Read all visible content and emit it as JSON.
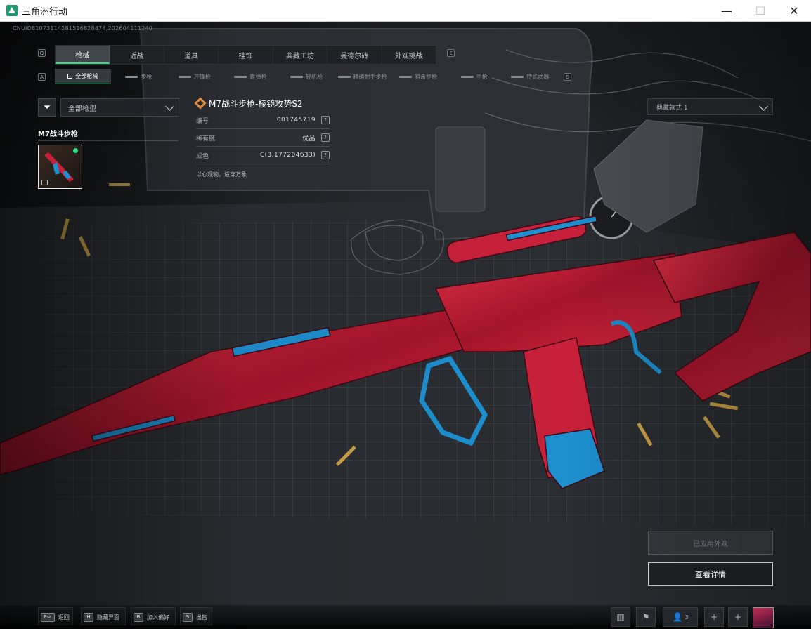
{
  "window": {
    "title": "三角洲行动",
    "controls": {
      "minimize": "—",
      "maximize": "☐",
      "close": "✕"
    }
  },
  "uid": "CNUID8107311428151682887​4,202604111240",
  "tabs": {
    "left_key": "Q",
    "right_key": "E",
    "items": [
      {
        "label": "枪械",
        "active": true
      },
      {
        "label": "近战",
        "active": false
      },
      {
        "label": "道具",
        "active": false
      },
      {
        "label": "挂饰",
        "active": false
      },
      {
        "label": "典藏工坊",
        "active": false
      },
      {
        "label": "曼德尔砖",
        "active": false
      },
      {
        "label": "外观挑战",
        "active": false
      }
    ]
  },
  "subtabs": {
    "left_key": "A",
    "right_key": "D",
    "items": [
      {
        "label": "全部枪械",
        "active": true
      },
      {
        "label": "步枪",
        "active": false
      },
      {
        "label": "冲锋枪",
        "active": false
      },
      {
        "label": "霰弹枪",
        "active": false
      },
      {
        "label": "轻机枪",
        "active": false
      },
      {
        "label": "精确射手步枪",
        "active": false
      },
      {
        "label": "狙击步枪",
        "active": false
      },
      {
        "label": "手枪",
        "active": false
      },
      {
        "label": "特殊武器",
        "active": false
      }
    ]
  },
  "filter": {
    "label": "全部枪型"
  },
  "group": {
    "title": "M7战斗步枪",
    "status_color": "#2ee07f"
  },
  "item": {
    "name": "M7战斗步枪-棱镜攻势S2",
    "rows": [
      {
        "label": "编号",
        "value": "001745719"
      },
      {
        "label": "稀有度",
        "value": "优品"
      },
      {
        "label": "成色",
        "value": "C(3.177204633)"
      }
    ],
    "description": "以心观物，适穿万象",
    "help_glyph": "?"
  },
  "style_select": {
    "label": "典藏款式 1"
  },
  "buttons": {
    "applied": "已应用外观",
    "details": "查看详情"
  },
  "bottom_hints": [
    {
      "key": "Esc",
      "label": "返回"
    },
    {
      "key": "H",
      "label": "隐藏界面"
    },
    {
      "key": "B",
      "label": "加入偏好"
    },
    {
      "key": "S",
      "label": "出售"
    }
  ],
  "bottom_tools": {
    "friends_count": "3",
    "plus_glyph": "+"
  },
  "colors": {
    "accent": "#2ee07f",
    "title_icon": "#e38b3c",
    "weapon_red": "#c8203a",
    "weapon_blue": "#1e8fcf"
  }
}
